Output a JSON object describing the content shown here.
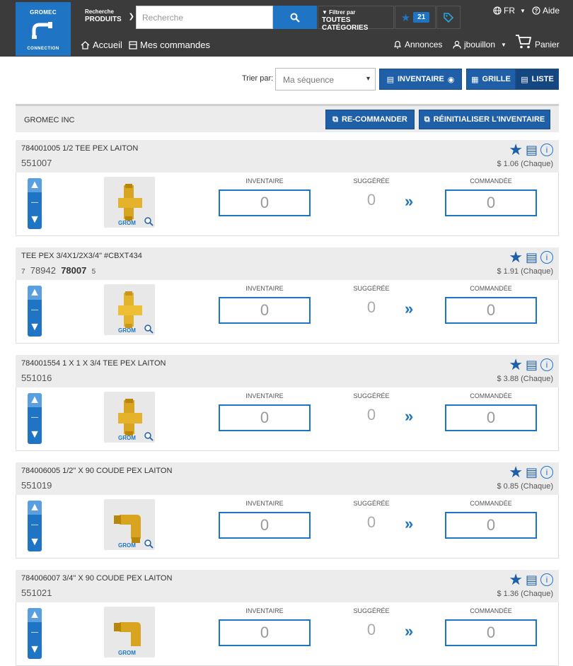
{
  "header": {
    "logo": {
      "brand": "GROMEC",
      "subtitle": "CONNECTION"
    },
    "search_scope": {
      "line1": "Recherche",
      "line2": "PRODUITS"
    },
    "search_placeholder": "Recherche",
    "filter": {
      "line1": "Filtrer par",
      "line2": "TOUTES CATÉGORIES"
    },
    "favorites_count": "21",
    "language": "FR",
    "help": "Aide",
    "nav": {
      "home": "Accueil",
      "orders": "Mes commandes",
      "announcements": "Annonces",
      "user": "jbouillon",
      "cart": "Panier"
    }
  },
  "toolbar": {
    "sort_label": "Trier par:",
    "sort_value": "Ma séquence",
    "inventory_button": "INVENTAIRE",
    "view_grid": "GRILLE",
    "view_list": "LISTE"
  },
  "company": {
    "name": "GROMEC INC",
    "reorder_button": "RE-COMMANDER",
    "reset_button": "RÉINITIALISER L'INVENTAIRE"
  },
  "columns": {
    "inventory": "INVENTAIRE",
    "suggested": "SUGGÉRÉE",
    "ordered": "COMMANDÉE"
  },
  "products": [
    {
      "description": "784001005 1/2 TEE PEX LAITON",
      "code": "551007",
      "price": "$ 1.06 (Chaque)",
      "inventory": "0",
      "suggested": "0",
      "ordered": "0",
      "image_wm": "GROM"
    },
    {
      "description": "TEE PEX 3/4X1/2X3/4\" #CBXT434",
      "code_a": "7",
      "code_b": "78942",
      "code_c": "78007",
      "code_d": "5",
      "price": "$ 1.91 (Chaque)",
      "inventory": "0",
      "suggested": "0",
      "ordered": "0",
      "image_wm": "GROM"
    },
    {
      "description": "784001554 1 X 1 X 3/4 TEE PEX LAITON",
      "code": "551016",
      "price": "$ 3.88 (Chaque)",
      "inventory": "0",
      "suggested": "0",
      "ordered": "0",
      "image_wm": "GROM"
    },
    {
      "description": "784006005 1/2\" X 90 COUDE PEX LAITON",
      "code": "551019",
      "price": "$ 0.85 (Chaque)",
      "inventory": "0",
      "suggested": "0",
      "ordered": "0",
      "image_wm": "GROM"
    },
    {
      "description": "784006007 3/4\" X 90 COUDE PEX LAITON",
      "code": "551021",
      "price": "$ 1.36 (Chaque)",
      "inventory": "0",
      "suggested": "0",
      "ordered": "0",
      "image_wm": "GROM"
    }
  ],
  "colors": {
    "primary": "#1f75c3",
    "dark_header": "#3b3b3b",
    "button": "#1f5fa8"
  }
}
